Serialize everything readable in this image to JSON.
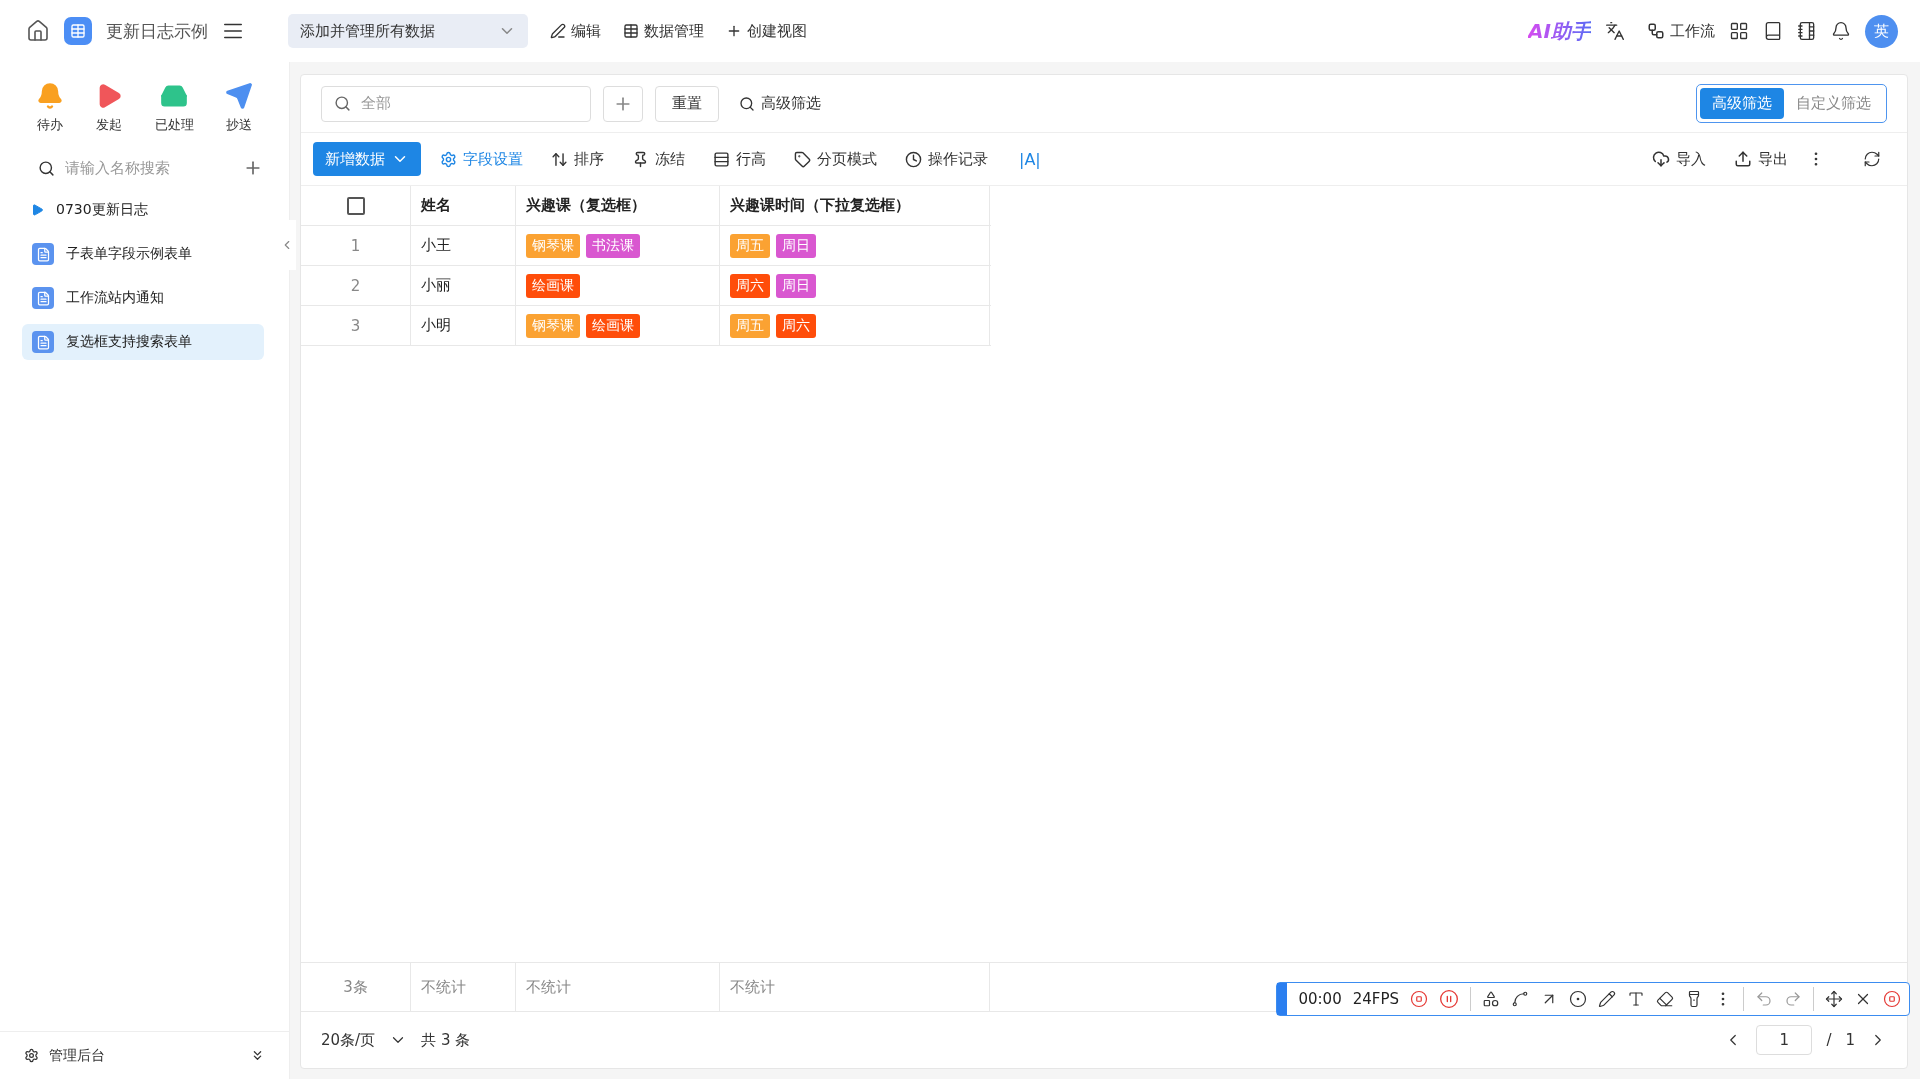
{
  "app": {
    "title": "更新日志示例"
  },
  "view_selector": {
    "value": "添加并管理所有数据"
  },
  "top_actions": [
    "编辑",
    "数据管理",
    "创建视图"
  ],
  "top_right": {
    "ai_label": "AI助手",
    "workflow": "工作流",
    "avatar": "英"
  },
  "quick_actions": [
    {
      "label": "待办"
    },
    {
      "label": "发起"
    },
    {
      "label": "已处理"
    },
    {
      "label": "抄送"
    }
  ],
  "sidebar": {
    "search_placeholder": "请输入名称搜索",
    "items": [
      {
        "label": "0730更新日志",
        "kind": "folder",
        "selected": false
      },
      {
        "label": "子表单字段示例表单",
        "kind": "form",
        "selected": false
      },
      {
        "label": "工作流站内通知",
        "kind": "form",
        "selected": false
      },
      {
        "label": "复选框支持搜索表单",
        "kind": "form",
        "selected": true
      }
    ],
    "footer": "管理后台"
  },
  "filter": {
    "search_placeholder": "全部",
    "reset": "重置",
    "advanced": "高级筛选",
    "modes": [
      {
        "label": "高级筛选",
        "selected": true
      },
      {
        "label": "自定义筛选",
        "selected": false
      }
    ]
  },
  "toolbar": {
    "add": "新增数据",
    "tools": [
      {
        "label": "字段设置",
        "active": true
      },
      {
        "label": "排序",
        "active": false
      },
      {
        "label": "冻结",
        "active": false
      },
      {
        "label": "行高",
        "active": false
      },
      {
        "label": "分页模式",
        "active": false
      },
      {
        "label": "操作记录",
        "active": false
      }
    ],
    "text_tool": "|A|",
    "right": [
      "导入",
      "导出"
    ]
  },
  "table": {
    "select_all": {
      "checked": false
    },
    "columns": [
      "姓名",
      "兴趣课（复选框）",
      "兴趣课时间（下拉复选框）"
    ],
    "rows": [
      {
        "index": "1",
        "name": "小王",
        "courses": [
          {
            "label": "钢琴课",
            "color": "#fba232"
          },
          {
            "label": "书法课",
            "color": "#d957d0"
          }
        ],
        "times": [
          {
            "label": "周五",
            "color": "#fba232"
          },
          {
            "label": "周日",
            "color": "#d957d0"
          }
        ]
      },
      {
        "index": "2",
        "name": "小丽",
        "courses": [
          {
            "label": "绘画课",
            "color": "#ff4d0a"
          }
        ],
        "times": [
          {
            "label": "周六",
            "color": "#ff4d0a"
          },
          {
            "label": "周日",
            "color": "#d957d0"
          }
        ]
      },
      {
        "index": "3",
        "name": "小明",
        "courses": [
          {
            "label": "钢琴课",
            "color": "#fba232"
          },
          {
            "label": "绘画课",
            "color": "#ff4d0a"
          }
        ],
        "times": [
          {
            "label": "周五",
            "color": "#fba232"
          },
          {
            "label": "周六",
            "color": "#ff4d0a"
          }
        ]
      }
    ],
    "summary": [
      "3条",
      "不统计",
      "不统计",
      "不统计"
    ]
  },
  "pagination": {
    "page_size": "20条/页",
    "total": "共 3 条",
    "page": "1",
    "separator": "/",
    "pages": "1"
  },
  "recorder": {
    "time": "00:00",
    "fps": "24FPS"
  }
}
